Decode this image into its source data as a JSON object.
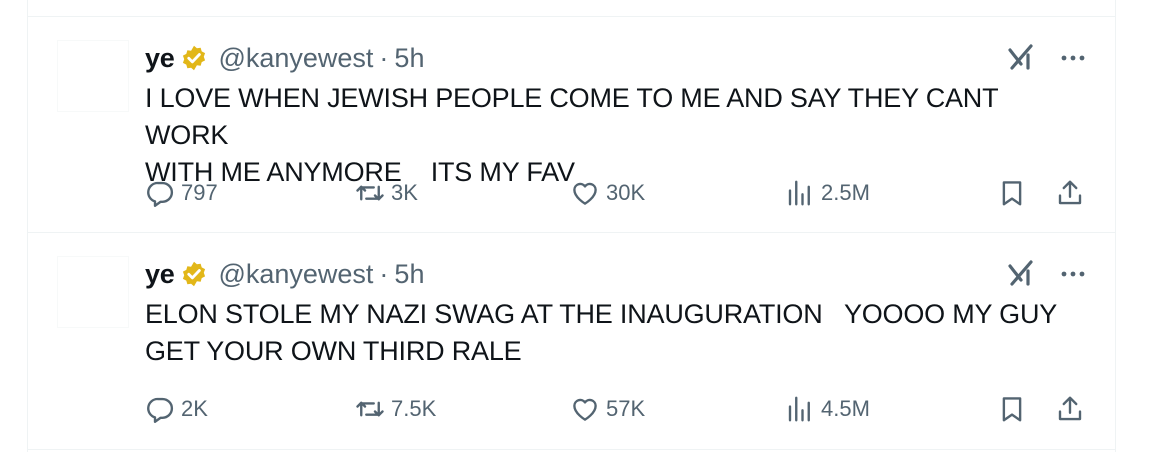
{
  "tweets": [
    {
      "author": {
        "name": "ye",
        "handle": "@kanyewest",
        "separator": "·",
        "time": "5h"
      },
      "text": "I LOVE WHEN JEWISH PEOPLE COME TO ME AND SAY THEY CANT WORK\nWITH ME ANYMORE    ITS MY FAV",
      "stats": {
        "replies": "797",
        "reposts": "3K",
        "likes": "30K",
        "views": "2.5M"
      }
    },
    {
      "author": {
        "name": "ye",
        "handle": "@kanyewest",
        "separator": "·",
        "time": "5h"
      },
      "text": "ELON STOLE MY NAZI SWAG AT THE INAUGURATION   YOOOO MY GUY\nGET YOUR OWN THIRD RALE",
      "stats": {
        "replies": "2K",
        "reposts": "7.5K",
        "likes": "57K",
        "views": "4.5M"
      }
    }
  ],
  "icons": {
    "verified": "verified-badge-icon",
    "grok": "grok-icon",
    "more": "more-icon",
    "reply": "reply-icon",
    "repost": "repost-icon",
    "like": "heart-icon",
    "views": "views-chart-icon",
    "bookmark": "bookmark-icon",
    "share": "share-icon"
  },
  "colors": {
    "text_primary": "#0f1419",
    "text_secondary": "#536471",
    "verified_gold": "#e2b719",
    "border": "#eff3f4"
  }
}
